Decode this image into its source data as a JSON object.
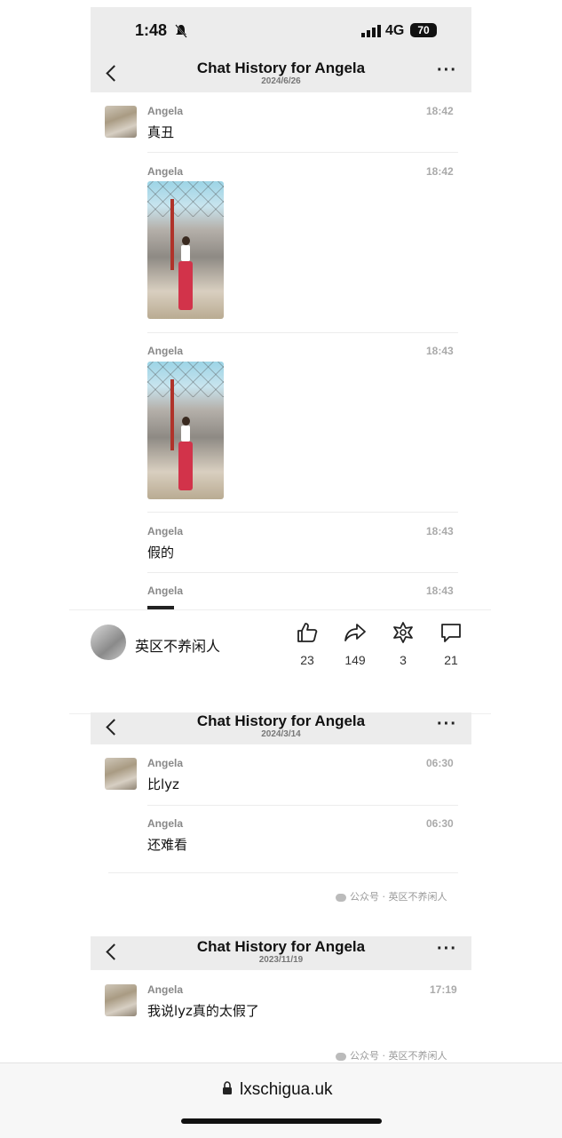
{
  "status_bar": {
    "time": "1:48",
    "network": "4G",
    "battery": "70"
  },
  "screens": [
    {
      "title": "Chat History for Angela",
      "date": "2024/6/26",
      "messages": [
        {
          "sender": "Angela",
          "time": "18:42",
          "text": "真丑"
        },
        {
          "sender": "Angela",
          "time": "18:42",
          "text": ""
        },
        {
          "sender": "Angela",
          "time": "18:43",
          "text": ""
        },
        {
          "sender": "Angela",
          "time": "18:43",
          "text": "假的"
        },
        {
          "sender": "Angela",
          "time": "18:43",
          "text": ""
        }
      ]
    },
    {
      "title": "Chat History for Angela",
      "date": "2024/3/14",
      "messages": [
        {
          "sender": "Angela",
          "time": "06:30",
          "text": "比lyz"
        },
        {
          "sender": "Angela",
          "time": "06:30",
          "text": "还难看"
        }
      ]
    },
    {
      "title": "Chat History for Angela",
      "date": "2023/11/19",
      "messages": [
        {
          "sender": "Angela",
          "time": "17:19",
          "text": "我说lyz真的太假了"
        }
      ]
    }
  ],
  "post": {
    "author": "英区不养闲人",
    "likes": "23",
    "shares": "149",
    "favorites": "3",
    "comments": "21"
  },
  "watermark": "公众号 · 英区不养闲人",
  "url": "lxschigua.uk",
  "icons": [
    "back-chevron-icon",
    "more-dots-icon",
    "like-icon",
    "share-icon",
    "favorite-icon",
    "comment-icon",
    "lock-icon",
    "wechat-icon"
  ]
}
